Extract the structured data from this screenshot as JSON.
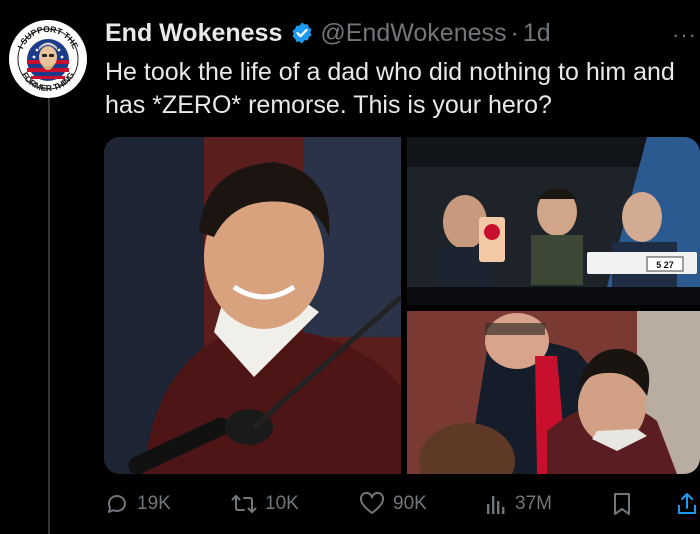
{
  "tweet": {
    "display_name": "End Wokeness",
    "handle": "@EndWokeness",
    "separator": "·",
    "time": "1d",
    "text": "He took the life of a dad who did nothing to him and has *ZERO* remorse. This is your hero?",
    "more": "···"
  },
  "avatar": {
    "top_text": "I SUPPORT THE",
    "bottom_text": "FORMER THING"
  },
  "media": {
    "photos": [
      {
        "icon": "courtroom-defendant-photo"
      },
      {
        "icon": "police-car-photo",
        "plate": "5 27"
      },
      {
        "icon": "courtroom-attorney-photo"
      }
    ]
  },
  "actions": {
    "replies": "19K",
    "reposts": "10K",
    "likes": "90K",
    "views": "37M"
  },
  "colors": {
    "background": "#000000",
    "text": "#e7e9ea",
    "muted": "#71767b",
    "verified": "#1d9bf0",
    "share": "#1d9bf0"
  }
}
